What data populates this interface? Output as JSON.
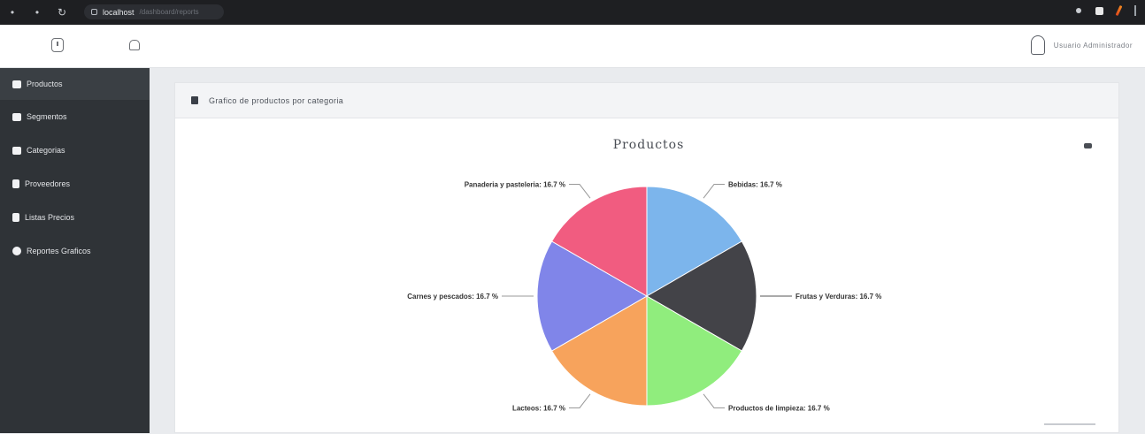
{
  "browser": {
    "url": "localhost",
    "url_rest": "/dashboard/reports"
  },
  "topbar": {
    "user_name": "Usuario Administrador"
  },
  "sidebar": {
    "items": [
      {
        "label": "Productos",
        "icon": "folder-icon",
        "active": true
      },
      {
        "label": "Segmentos",
        "icon": "tag-icon",
        "active": false
      },
      {
        "label": "Categorias",
        "icon": "folder-icon",
        "active": false
      },
      {
        "label": "Proveedores",
        "icon": "document-icon",
        "active": false
      },
      {
        "label": "Listas Precios",
        "icon": "list-icon",
        "active": false
      },
      {
        "label": "Reportes Graficos",
        "icon": "circle-icon",
        "active": false
      }
    ]
  },
  "panel": {
    "title": "Grafico de productos por categoria"
  },
  "chart_data": {
    "type": "pie",
    "title": "Productos",
    "slices": [
      {
        "label": "Bebidas",
        "value": 16.7,
        "display": "Bebidas: 16.7 %",
        "color": "#7cb5ec"
      },
      {
        "label": "Frutas y Verduras",
        "value": 16.7,
        "display": "Frutas y Verduras: 16.7 %",
        "color": "#434348"
      },
      {
        "label": "Productos de limpieza",
        "value": 16.7,
        "display": "Productos de limpieza: 16.7 %",
        "color": "#90ed7d"
      },
      {
        "label": "Lacteos",
        "value": 16.7,
        "display": "Lacteos: 16.7 %",
        "color": "#f7a35c"
      },
      {
        "label": "Carnes y pescados",
        "value": 16.7,
        "display": "Carnes y pescados: 16.7 %",
        "color": "#8085e9"
      },
      {
        "label": "Panaderia y pasteleria",
        "value": 16.7,
        "display": "Panaderia y pasteleria: 16.7 %",
        "color": "#f15c80"
      }
    ]
  }
}
